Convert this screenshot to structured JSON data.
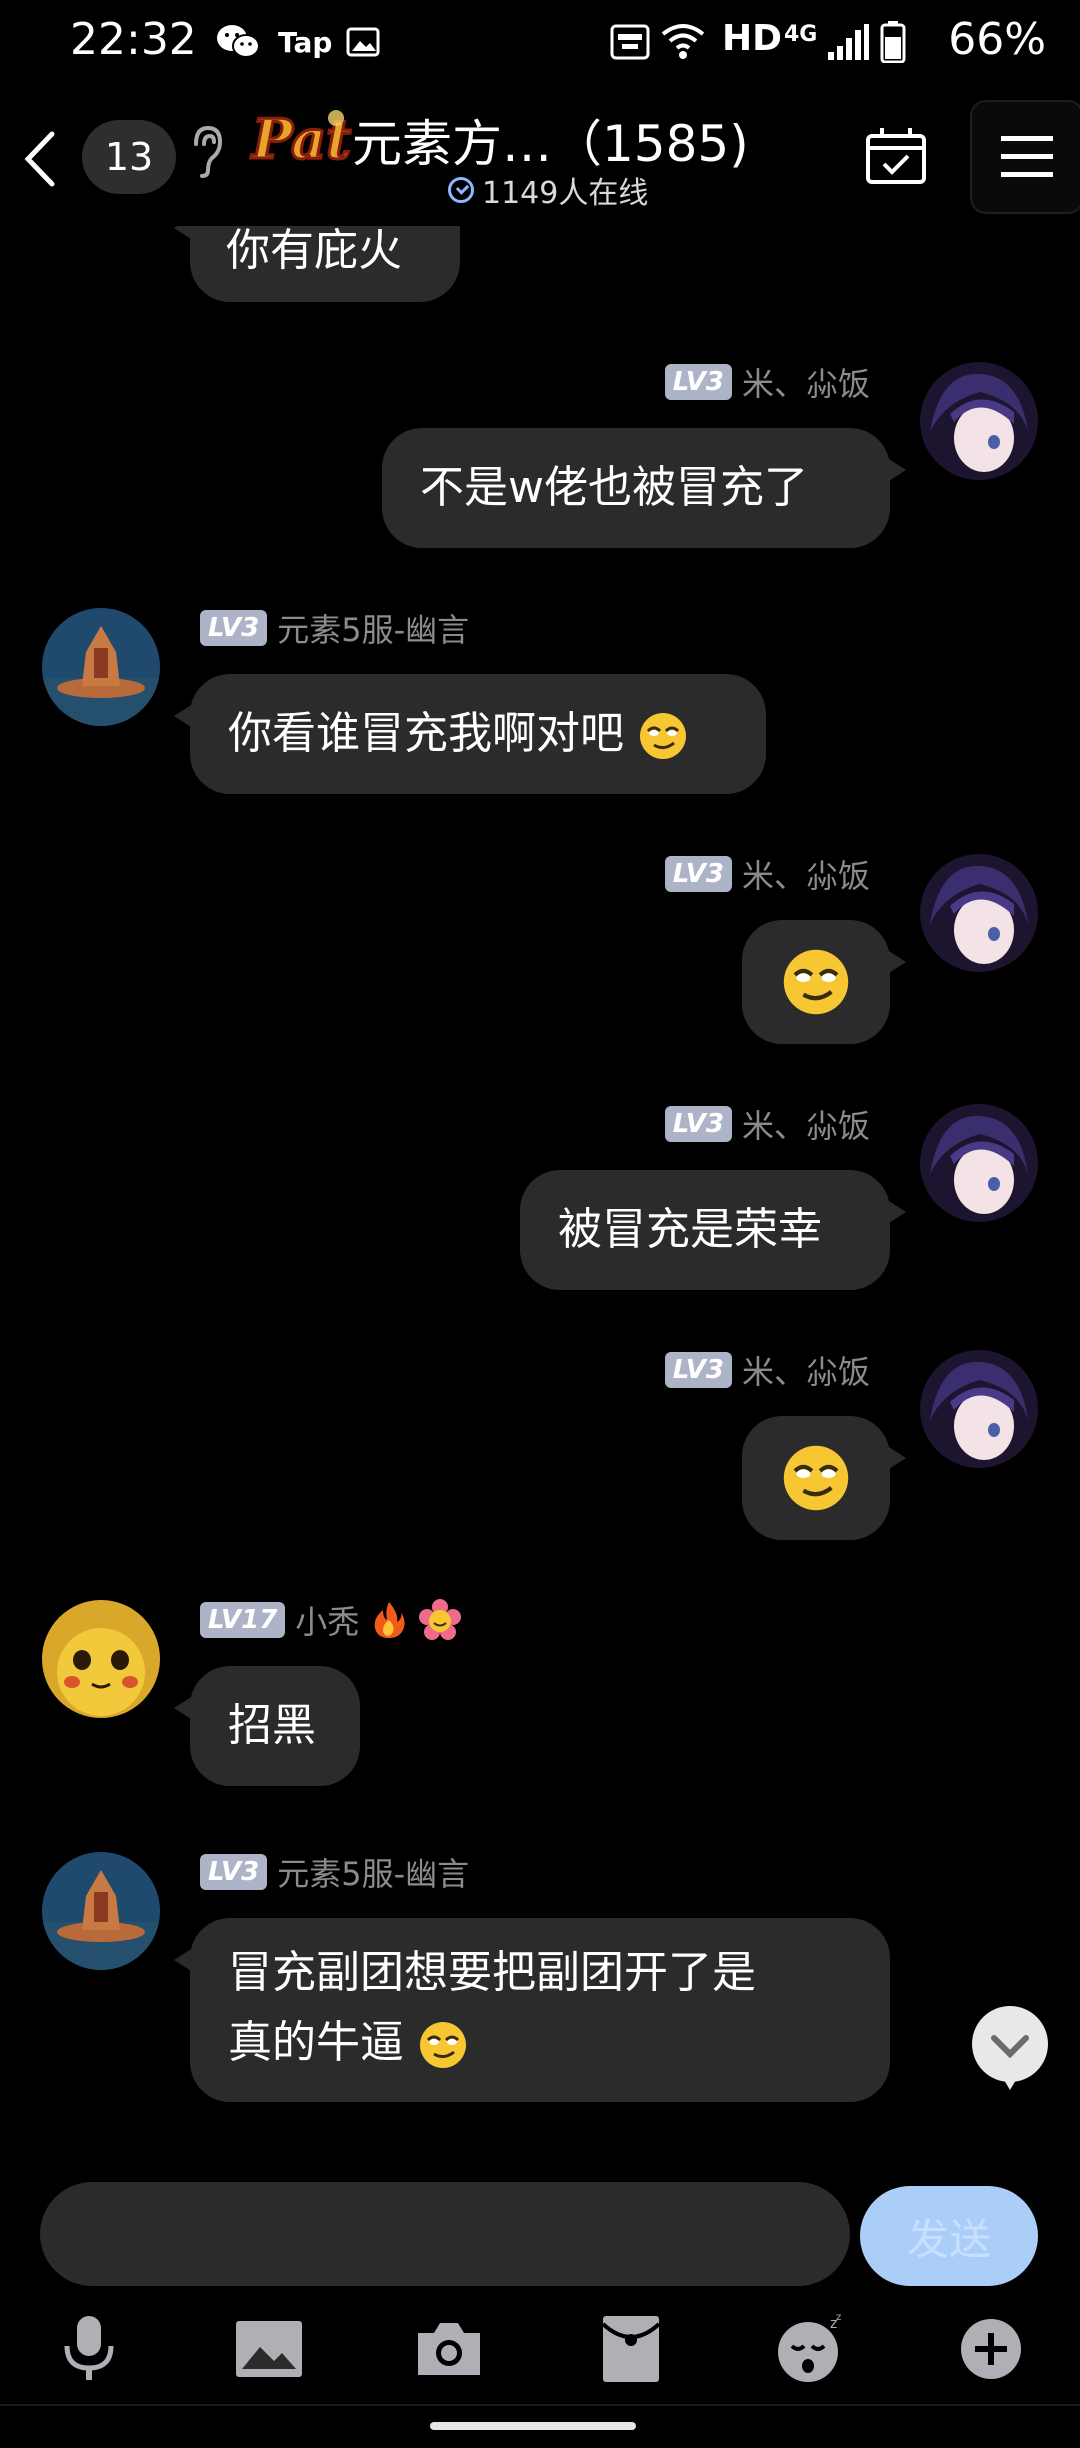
{
  "status_bar": {
    "time": "22:32",
    "carrier_tap": "Tap",
    "hd": "HD",
    "net": "4G",
    "battery": "66%"
  },
  "header": {
    "unread_count": "13",
    "logo_text": "Pat",
    "title": "元素方…（1585)",
    "online": "1149人在线"
  },
  "messages": {
    "top_partial": "你有庇火",
    "m1": {
      "level": "LV3",
      "name": "米、尛饭",
      "text": "不是w佬也被冒充了"
    },
    "m2": {
      "level": "LV3",
      "name": "元素5服-幽言",
      "text": "你看谁冒充我啊对吧"
    },
    "m3": {
      "level": "LV3",
      "name": "米、尛饭"
    },
    "m4": {
      "level": "LV3",
      "name": "米、尛饭",
      "text": "被冒充是荣幸"
    },
    "m5": {
      "level": "LV3",
      "name": "米、尛饭"
    },
    "m6": {
      "level": "LV17",
      "name": "小秃",
      "text": "招黑"
    },
    "m7": {
      "level": "LV3",
      "name": "元素5服-幽言",
      "line1": "冒充副团想要把副团开了是",
      "line2": "真的牛逼"
    }
  },
  "input": {
    "value": "",
    "send_label": "发送"
  },
  "toolbar_icons": [
    "microphone-icon",
    "image-icon",
    "camera-icon",
    "red-packet-icon",
    "sticker-icon",
    "plus-icon"
  ],
  "colors": {
    "bubble": "#2b2b2b",
    "level_badge": "#aeb4c8",
    "send_button": "#aacef8"
  }
}
